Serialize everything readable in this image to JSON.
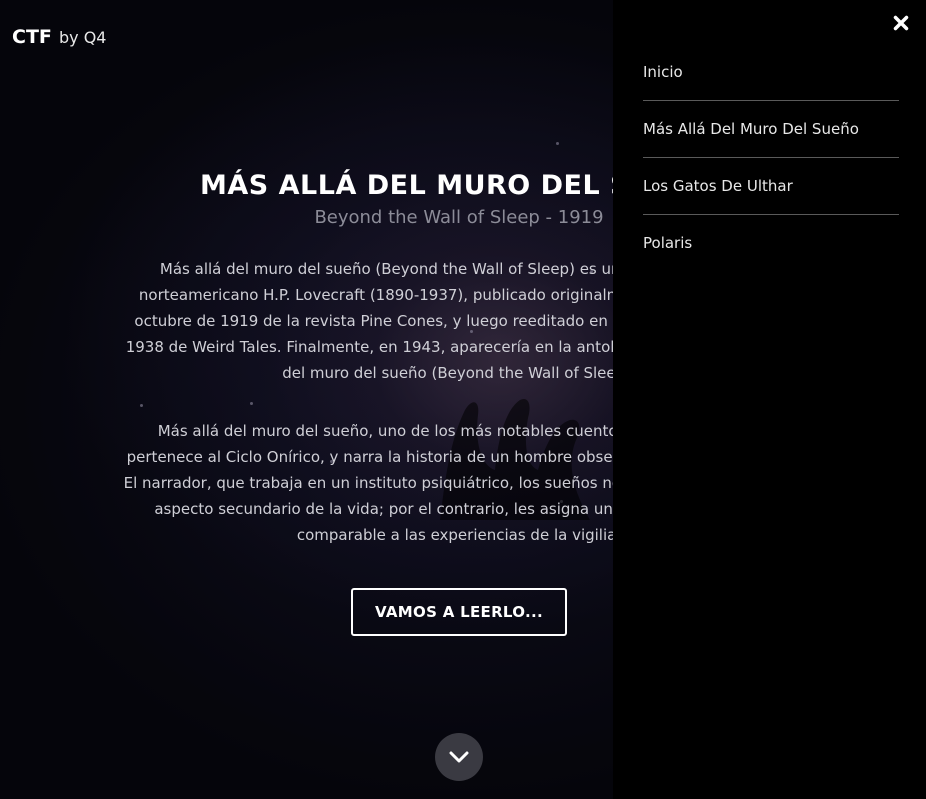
{
  "brand": {
    "name": "CTF",
    "byline": "by Q4"
  },
  "hero": {
    "title": "MÁS ALLÁ DEL MURO DEL SUEÑO",
    "subtitle": "Beyond the Wall of Sleep - 1919",
    "paragraph_1": "Más allá del muro del sueño (Beyond the Wall of Sleep) es un relato del escritor norteamericano H.P. Lovecraft (1890-1937), publicado originalmente en la edición de octubre de 1919 de la revista Pine Cones, y luego reeditado en la edición de marzo de 1938 de Weird Tales. Finalmente, en 1943, aparecería en la antología de relatos Más allá del muro del sueño (Beyond the Wall of Sleep).",
    "paragraph_2": "Más allá del muro del sueño, uno de los más notables cuentos de H.P. Lovecraft, pertenece al Ciclo Onírico, y narra la historia de un hombre obsesionado con los sueños. El narrador, que trabaja en un instituto psiquiátrico, los sueños no constituyen para él un aspecto secundario de la vida; por el contrario, les asigna un valor y una entidad comparable a las experiencias de la vigilia.",
    "cta_label": "VAMOS A LEERLO...",
    "scroll_icon": "chevron-down-icon"
  },
  "nav": {
    "close_icon": "close-icon",
    "items": [
      {
        "label": "Inicio"
      },
      {
        "label": "Más Allá Del Muro Del Sueño"
      },
      {
        "label": "Los Gatos De Ulthar"
      },
      {
        "label": "Polaris"
      }
    ]
  },
  "colors": {
    "nav_background": "#000000",
    "hero_background": "#0b0b14",
    "text_primary": "#ffffff",
    "subtitle": "#8c8c98",
    "scroll_button": "#3a3a42",
    "divider": "#5a5a5a"
  }
}
